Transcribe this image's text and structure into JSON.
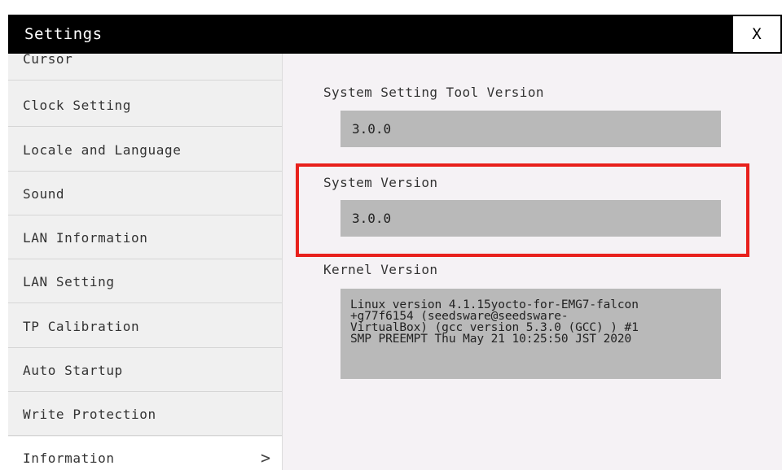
{
  "window": {
    "title": "Settings",
    "close_label": "X"
  },
  "sidebar": {
    "items": [
      {
        "label": "Cursor"
      },
      {
        "label": "Clock Setting"
      },
      {
        "label": "Locale and Language"
      },
      {
        "label": "Sound"
      },
      {
        "label": "LAN Information"
      },
      {
        "label": "LAN Setting"
      },
      {
        "label": "TP Calibration"
      },
      {
        "label": "Auto Startup"
      },
      {
        "label": "Write Protection"
      },
      {
        "label": "Information",
        "active": true,
        "chevron": ">"
      }
    ]
  },
  "info": {
    "tool_version_label": "System Setting Tool Version",
    "tool_version_value": "3.0.0",
    "system_version_label": "System Version",
    "system_version_value": "3.0.0",
    "kernel_version_label": "Kernel Version",
    "kernel_version_value": "Linux version 4.1.15yocto-for-EMG7-falcon\n+g77f6154 (seedsware@seedsware-\nVirtualBox) (gcc version 5.3.0 (GCC) ) #1\nSMP PREEMPT Thu May 21 10:25:50 JST 2020"
  },
  "colors": {
    "titlebar": "#000000",
    "highlight_border": "#e8201c",
    "value_box": "#b9b9b9",
    "sidebar_bg": "#f0f0f0",
    "content_bg": "#f5f2f5"
  }
}
